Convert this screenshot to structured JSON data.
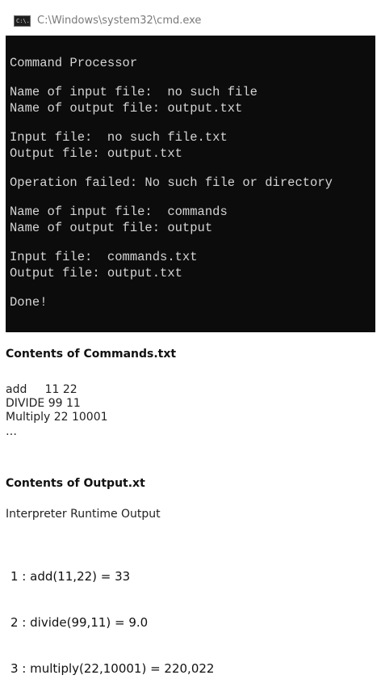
{
  "window": {
    "title": "C:\\Windows\\system32\\cmd.exe",
    "icon_name": "cmd-app-icon",
    "icon_text": "C:\\."
  },
  "console": {
    "lines": [
      "Command Processor",
      "",
      "Name of input file:  no such file",
      "Name of output file: output.txt",
      "",
      "Input file:  no such file.txt",
      "Output file: output.txt",
      "",
      "Operation failed: No such file or directory",
      "",
      "Name of input file:  commands",
      "Name of output file: output",
      "",
      "Input file:  commands.txt",
      "Output file: output.txt",
      "",
      "Done!"
    ]
  },
  "commands_section": {
    "heading": "Contents of Commands.txt",
    "lines": [
      "add     11 22",
      "DIVIDE 99 11",
      "Multiply 22 10001",
      "…"
    ]
  },
  "output_section": {
    "heading": "Contents of Output.xt",
    "subtitle": "Interpreter Runtime Output",
    "lines": [
      "1 : add(11,22) = 33",
      "2 : divide(99,11) = 9.0",
      "3 : multiply(22,10001) = 220,022"
    ]
  },
  "colors": {
    "console_background": "#0c0c0c",
    "console_text": "#d4d4d4",
    "titlebar_background": "#ffffff",
    "titlebar_text": "#7a7a7a"
  }
}
